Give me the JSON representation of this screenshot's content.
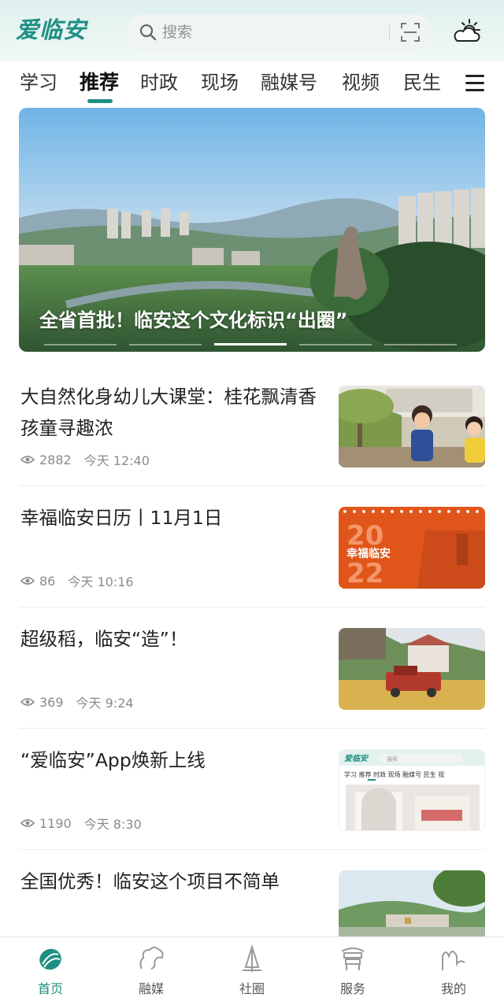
{
  "header": {
    "logo_text": "爱临安",
    "search_placeholder": "搜索",
    "icons": [
      "search-icon",
      "scan-icon",
      "weather-icon"
    ],
    "accent_color": "#1f8f83"
  },
  "tabs": [
    {
      "label": "学习",
      "active": false
    },
    {
      "label": "推荐",
      "active": true
    },
    {
      "label": "时政",
      "active": false
    },
    {
      "label": "现场",
      "active": false
    },
    {
      "label": "融媒号",
      "active": false
    },
    {
      "label": "视频",
      "active": false
    },
    {
      "label": "民生",
      "active": false
    }
  ],
  "banner": {
    "caption": "全省首批！临安这个文化标识“出圈”",
    "slide_count": 5,
    "active_slide": 3
  },
  "news": [
    {
      "title": "大自然化身幼儿大课堂：桂花飘清香 孩童寻趣浓",
      "views": "2882",
      "time": "今天 12:40"
    },
    {
      "title": "幸福临安日历丨11月1日",
      "views": "86",
      "time": "今天 10:16"
    },
    {
      "title": "超级稻，临安“造”！",
      "views": "369",
      "time": "今天 9:24"
    },
    {
      "title": "“爱临安”App焕新上线",
      "views": "1190",
      "time": "今天 8:30"
    },
    {
      "title": "全国优秀！临安这个项目不简单",
      "views": "",
      "time": ""
    }
  ],
  "thumb_text": {
    "calendar_year_top": "20",
    "calendar_year_bottom": "22",
    "calendar_label": "幸福临安",
    "screenshot_logo": "爱临安",
    "screenshot_search": "搜索",
    "screenshot_tabs": "学习 推荐 时政 现场 融媒号 民生 视"
  },
  "bottom_nav": [
    {
      "label": "首页",
      "icon": "home-icon",
      "active": true
    },
    {
      "label": "融媒",
      "icon": "media-icon",
      "active": false
    },
    {
      "label": "社圈",
      "icon": "community-icon",
      "active": false
    },
    {
      "label": "服务",
      "icon": "service-icon",
      "active": false
    },
    {
      "label": "我的",
      "icon": "profile-icon",
      "active": false
    }
  ]
}
